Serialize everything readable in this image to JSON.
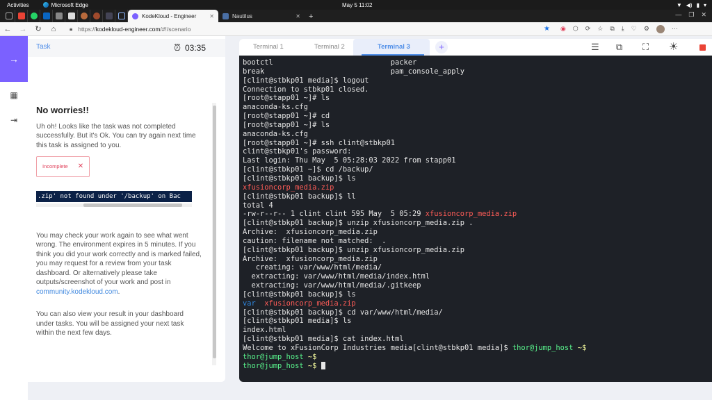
{
  "system_bar": {
    "activities": "Activities",
    "app_name": "Microsoft Edge",
    "clock": "May 5  11:02"
  },
  "browser": {
    "tabs": [
      {
        "title": "KodeKloud - Engineer",
        "active": true
      },
      {
        "title": "Nautilus",
        "active": false
      }
    ],
    "url": "https://kodekloud-engineer.com/#!/scenario",
    "url_host": "kodekloud-engineer.com",
    "url_prefix": "https://",
    "url_suffix": "/#!/scenario"
  },
  "task_panel": {
    "tab_label": "Task",
    "timer": "03:35",
    "heading": "No worries!!",
    "intro": "Uh oh! Looks like the task was not completed successfully. But it's Ok. You can try again next time this task is assigned to you.",
    "status_badge": "Incomplete",
    "error_message": ".zip' not found under '/backup' on Bac",
    "check_text": "You may check your work again to see what went wrong. The environment expires in 5 minutes. If you think you did your work correctly and is marked failed, you may request for a review from your task dashboard. Or alternatively please take outputs/screenshot of your work and post in ",
    "community_link": "community.kodekloud.com",
    "check_text_end": ".",
    "dashboard_text": "You can also view your result in your dashboard under tasks. You will be assigned your next task within the next few days."
  },
  "terminal": {
    "tabs": [
      "Terminal 1",
      "Terminal 2",
      "Terminal 3"
    ],
    "active_tab": "Terminal 3",
    "lines": [
      [
        {
          "t": "bootctl                           packer"
        }
      ],
      [
        {
          "t": "break                             pam_console_apply"
        }
      ],
      [
        {
          "t": "[clint@stbkp01 media]$ logout"
        }
      ],
      [
        {
          "t": "Connection to stbkp01 closed."
        }
      ],
      [
        {
          "t": "[root@stapp01 ~]# ls"
        }
      ],
      [
        {
          "t": "anaconda-ks.cfg"
        }
      ],
      [
        {
          "t": "[root@stapp01 ~]# cd"
        }
      ],
      [
        {
          "t": "[root@stapp01 ~]# ls"
        }
      ],
      [
        {
          "t": "anaconda-ks.cfg"
        }
      ],
      [
        {
          "t": "[root@stapp01 ~]# ssh clint@stbkp01"
        }
      ],
      [
        {
          "t": "clint@stbkp01's password:"
        }
      ],
      [
        {
          "t": "Last login: Thu May  5 05:28:03 2022 from stapp01"
        }
      ],
      [
        {
          "t": "[clint@stbkp01 ~]$ cd /backup/"
        }
      ],
      [
        {
          "t": "[clint@stbkp01 backup]$ ls"
        }
      ],
      [
        {
          "t": "xfusioncorp_media.zip",
          "c": "red"
        }
      ],
      [
        {
          "t": "[clint@stbkp01 backup]$ ll"
        }
      ],
      [
        {
          "t": "total 4"
        }
      ],
      [
        {
          "t": "-rw-r--r-- 1 clint clint 595 May  5 05:29 "
        },
        {
          "t": "xfusioncorp_media.zip",
          "c": "red"
        }
      ],
      [
        {
          "t": "[clint@stbkp01 backup]$ unzip xfusioncorp_media.zip ."
        }
      ],
      [
        {
          "t": "Archive:  xfusioncorp_media.zip"
        }
      ],
      [
        {
          "t": "caution: filename not matched:  ."
        }
      ],
      [
        {
          "t": "[clint@stbkp01 backup]$ unzip xfusioncorp_media.zip"
        }
      ],
      [
        {
          "t": "Archive:  xfusioncorp_media.zip"
        }
      ],
      [
        {
          "t": "   creating: var/www/html/media/"
        }
      ],
      [
        {
          "t": "  extracting: var/www/html/media/index.html"
        }
      ],
      [
        {
          "t": "  extracting: var/www/html/media/.gitkeep"
        }
      ],
      [
        {
          "t": "[clint@stbkp01 backup]$ ls"
        }
      ],
      [
        {
          "t": "var",
          "c": "blue"
        },
        {
          "t": "  "
        },
        {
          "t": "xfusioncorp_media.zip",
          "c": "red"
        }
      ],
      [
        {
          "t": "[clint@stbkp01 backup]$ cd var/www/html/media/"
        }
      ],
      [
        {
          "t": "[clint@stbkp01 media]$ ls"
        }
      ],
      [
        {
          "t": "index.html"
        }
      ],
      [
        {
          "t": "[clint@stbkp01 media]$ cat index.html"
        }
      ],
      [
        {
          "t": "Welcome to xFusionCorp Industries media[clint@stbkp01 media]$ "
        },
        {
          "t": "thor@jump_host",
          "c": "green"
        },
        {
          "t": " ~$",
          "c": "yellow"
        }
      ],
      [
        {
          "t": "thor@jump_host",
          "c": "green"
        },
        {
          "t": " ~$",
          "c": "yellow"
        }
      ],
      [
        {
          "t": "thor@jump_host",
          "c": "green"
        },
        {
          "t": " ~$ ",
          "c": "yellow"
        },
        {
          "cursor": true
        }
      ]
    ]
  }
}
